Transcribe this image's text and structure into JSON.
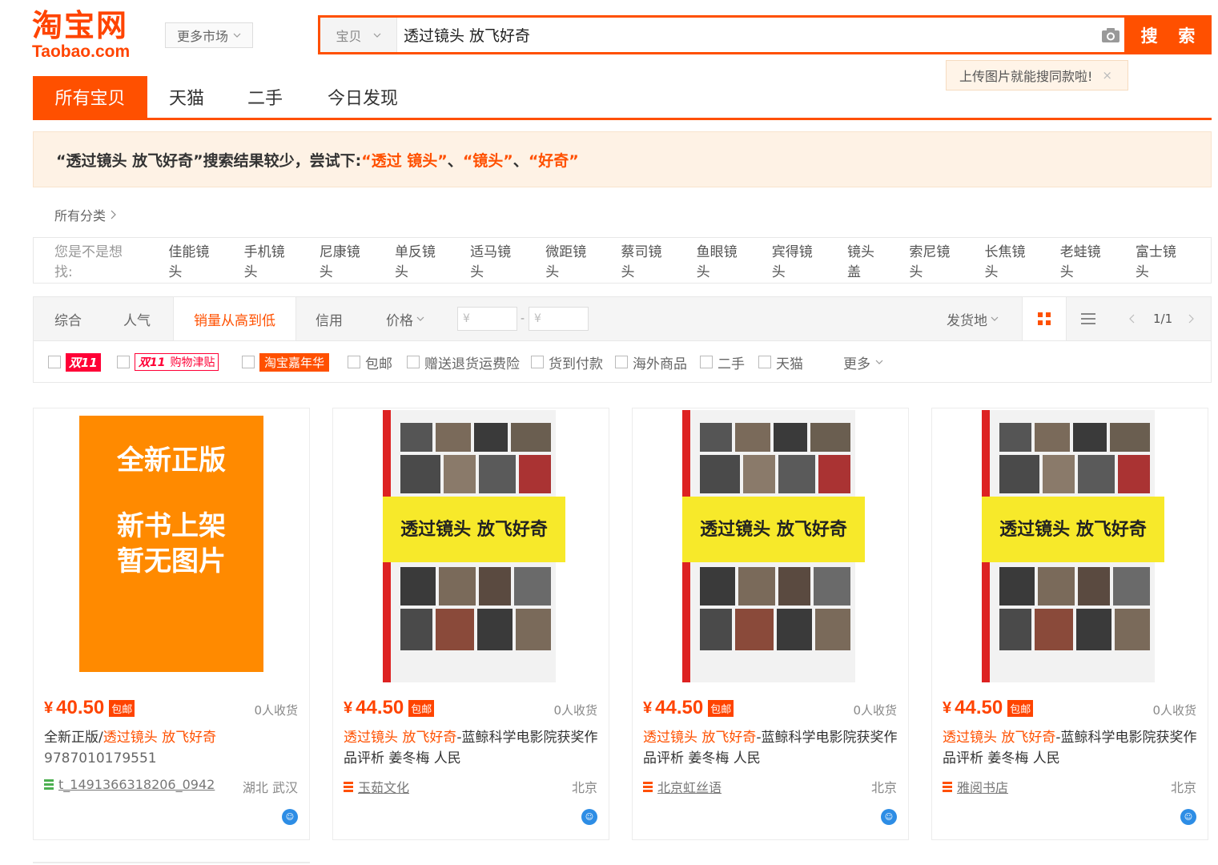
{
  "logo": {
    "cn": "淘宝网",
    "en": "Taobao.com"
  },
  "header": {
    "market_label": "更多市场",
    "search_category": "宝贝",
    "search_value": "透过镜头 放飞好奇",
    "search_button": "搜 索",
    "tooltip": "上传图片就能搜同款啦!",
    "tooltip_close": "×"
  },
  "tabs": [
    "所有宝贝",
    "天猫",
    "二手",
    "今日发现"
  ],
  "banner": {
    "prefix": "“透过镜头 放飞好奇”搜索结果较少，尝试下:",
    "suggestions": [
      "“透过 镜头”",
      "“镜头”",
      "“好奇”"
    ],
    "sep": "、"
  },
  "all_categories": "所有分类",
  "related": {
    "label": "您是不是想找:",
    "items": [
      "佳能镜头",
      "手机镜头",
      "尼康镜头",
      "单反镜头",
      "适马镜头",
      "微距镜头",
      "蔡司镜头",
      "鱼眼镜头",
      "宾得镜头",
      "镜头盖",
      "索尼镜头",
      "长焦镜头",
      "老蛙镜头",
      "富士镜头"
    ]
  },
  "sort": {
    "items": [
      "综合",
      "人气",
      "销量从高到低",
      "信用"
    ],
    "price_label": "价格",
    "price_min_placeholder": "¥",
    "price_max_placeholder": "¥",
    "price_dash": "-",
    "ship_from": "发货地",
    "page": "1/1"
  },
  "filters": {
    "d11": "双11",
    "d11_sub": "双11",
    "d11_sub2": "购物津贴",
    "jnh": "淘宝嘉年华",
    "opts": [
      "包邮",
      "赠送退货运费险",
      "货到付款",
      "海外商品",
      "二手",
      "天猫"
    ],
    "more": "更多"
  },
  "placeholder_cover": {
    "line1": "全新正版",
    "line2": "新书上架",
    "line3": "暂无图片"
  },
  "book_cover": {
    "title": "透过镜头 放飞好奇"
  },
  "products": [
    {
      "price": "40.50",
      "baoyou": "包邮",
      "sold": "0人收货",
      "title_pre": "全新正版/",
      "title_hl": "透过镜头 放飞好奇",
      "title_post": "",
      "title_line2": "9787010179551",
      "shop": "t_1491366318206_0942",
      "location": "湖北 武汉"
    },
    {
      "price": "44.50",
      "baoyou": "包邮",
      "sold": "0人收货",
      "title_pre": "",
      "title_hl": "透过镜头 放飞好奇",
      "title_post": "-蓝鲸科学电影院获奖作品评析 姜冬梅 人民",
      "title_line2": "",
      "shop": "玉茹文化",
      "location": "北京"
    },
    {
      "price": "44.50",
      "baoyou": "包邮",
      "sold": "0人收货",
      "title_pre": "",
      "title_hl": "透过镜头 放飞好奇",
      "title_post": "-蓝鲸科学电影院获奖作品评析 姜冬梅 人民",
      "title_line2": "",
      "shop": "北京虹丝语",
      "location": "北京"
    },
    {
      "price": "44.50",
      "baoyou": "包邮",
      "sold": "0人收货",
      "title_pre": "",
      "title_hl": "透过镜头 放飞好奇",
      "title_post": "-蓝鲸科学电影院获奖作品评析 姜冬梅 人民",
      "title_line2": "",
      "shop": "雅阅书店",
      "location": "北京"
    }
  ],
  "colors": {
    "accent": "#ff5000",
    "price": "#ff4400",
    "tmall_red": "#ff0036",
    "cover_orange": "#ff8a00",
    "cover_yellow": "#f7e92a"
  },
  "icons": [
    "chevron-down-icon",
    "camera-icon",
    "close-icon",
    "chevron-right-icon",
    "grid-view-icon",
    "list-view-icon",
    "chevron-left-icon",
    "shop-icon",
    "wangwang-icon"
  ]
}
